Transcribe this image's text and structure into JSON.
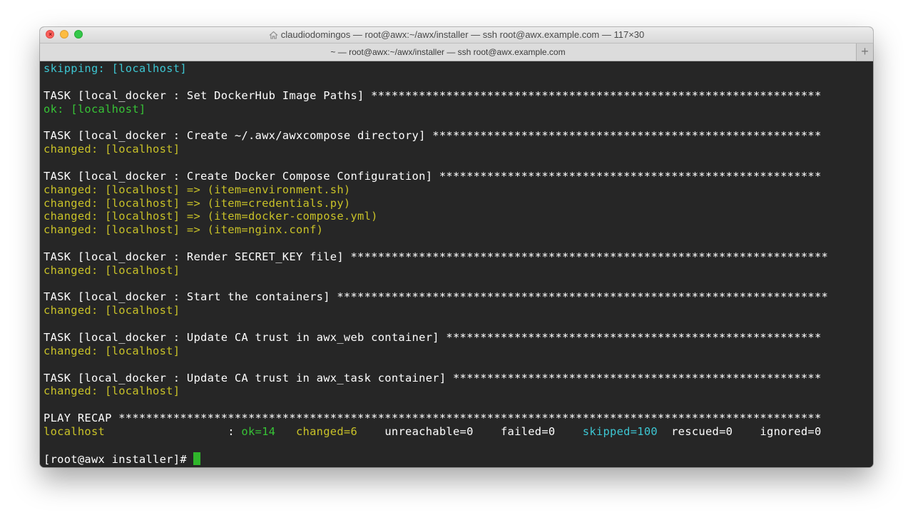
{
  "window": {
    "title": "claudiodomingos — root@awx:~/awx/installer — ssh root@awx.example.com — 117×30",
    "tab_label": "~ — root@awx:~/awx/installer — ssh root@awx.example.com",
    "new_tab": "+",
    "close_glyph": "×"
  },
  "terminal": {
    "lines": [
      {
        "segments": [
          {
            "text": "skipping: [localhost]",
            "color": "cyan"
          }
        ]
      },
      {
        "segments": []
      },
      {
        "segments": [
          {
            "text": "TASK [local_docker : Set DockerHub Image Paths] ******************************************************************",
            "color": "white"
          }
        ]
      },
      {
        "segments": [
          {
            "text": "ok: [localhost]",
            "color": "green"
          }
        ]
      },
      {
        "segments": []
      },
      {
        "segments": [
          {
            "text": "TASK [local_docker : Create ~/.awx/awxcompose directory] *********************************************************",
            "color": "white"
          }
        ]
      },
      {
        "segments": [
          {
            "text": "changed: [localhost]",
            "color": "yellow"
          }
        ]
      },
      {
        "segments": []
      },
      {
        "segments": [
          {
            "text": "TASK [local_docker : Create Docker Compose Configuration] ********************************************************",
            "color": "white"
          }
        ]
      },
      {
        "segments": [
          {
            "text": "changed: [localhost] => (item=environment.sh)",
            "color": "yellow"
          }
        ]
      },
      {
        "segments": [
          {
            "text": "changed: [localhost] => (item=credentials.py)",
            "color": "yellow"
          }
        ]
      },
      {
        "segments": [
          {
            "text": "changed: [localhost] => (item=docker-compose.yml)",
            "color": "yellow"
          }
        ]
      },
      {
        "segments": [
          {
            "text": "changed: [localhost] => (item=nginx.conf)",
            "color": "yellow"
          }
        ]
      },
      {
        "segments": []
      },
      {
        "segments": [
          {
            "text": "TASK [local_docker : Render SECRET_KEY file] **********************************************************************",
            "color": "white"
          }
        ]
      },
      {
        "segments": [
          {
            "text": "changed: [localhost]",
            "color": "yellow"
          }
        ]
      },
      {
        "segments": []
      },
      {
        "segments": [
          {
            "text": "TASK [local_docker : Start the containers] ************************************************************************",
            "color": "white"
          }
        ]
      },
      {
        "segments": [
          {
            "text": "changed: [localhost]",
            "color": "yellow"
          }
        ]
      },
      {
        "segments": []
      },
      {
        "segments": [
          {
            "text": "TASK [local_docker : Update CA trust in awx_web container] *******************************************************",
            "color": "white"
          }
        ]
      },
      {
        "segments": [
          {
            "text": "changed: [localhost]",
            "color": "yellow"
          }
        ]
      },
      {
        "segments": []
      },
      {
        "segments": [
          {
            "text": "TASK [local_docker : Update CA trust in awx_task container] ******************************************************",
            "color": "white"
          }
        ]
      },
      {
        "segments": [
          {
            "text": "changed: [localhost]",
            "color": "yellow"
          }
        ]
      },
      {
        "segments": []
      },
      {
        "segments": [
          {
            "text": "PLAY RECAP *******************************************************************************************************",
            "color": "white"
          }
        ]
      },
      {
        "segments": [
          {
            "text": "localhost",
            "color": "yellow"
          },
          {
            "text": "                  : ",
            "color": "white"
          },
          {
            "text": "ok=14",
            "color": "green"
          },
          {
            "text": "   ",
            "color": "white"
          },
          {
            "text": "changed=6",
            "color": "yellow"
          },
          {
            "text": "    unreachable=0    failed=0    ",
            "color": "white"
          },
          {
            "text": "skipped=100",
            "color": "cyan"
          },
          {
            "text": "  rescued=0    ignored=0",
            "color": "white"
          }
        ]
      },
      {
        "segments": []
      },
      {
        "segments": [
          {
            "text": "[root@awx installer]# ",
            "color": "white"
          }
        ],
        "cursor": true
      }
    ]
  },
  "colors": {
    "background": "#262626",
    "white": "#ffffff",
    "green": "#37c336",
    "yellow": "#c9c228",
    "cyan": "#3dc6d2",
    "cursor": "#2fb52b"
  }
}
